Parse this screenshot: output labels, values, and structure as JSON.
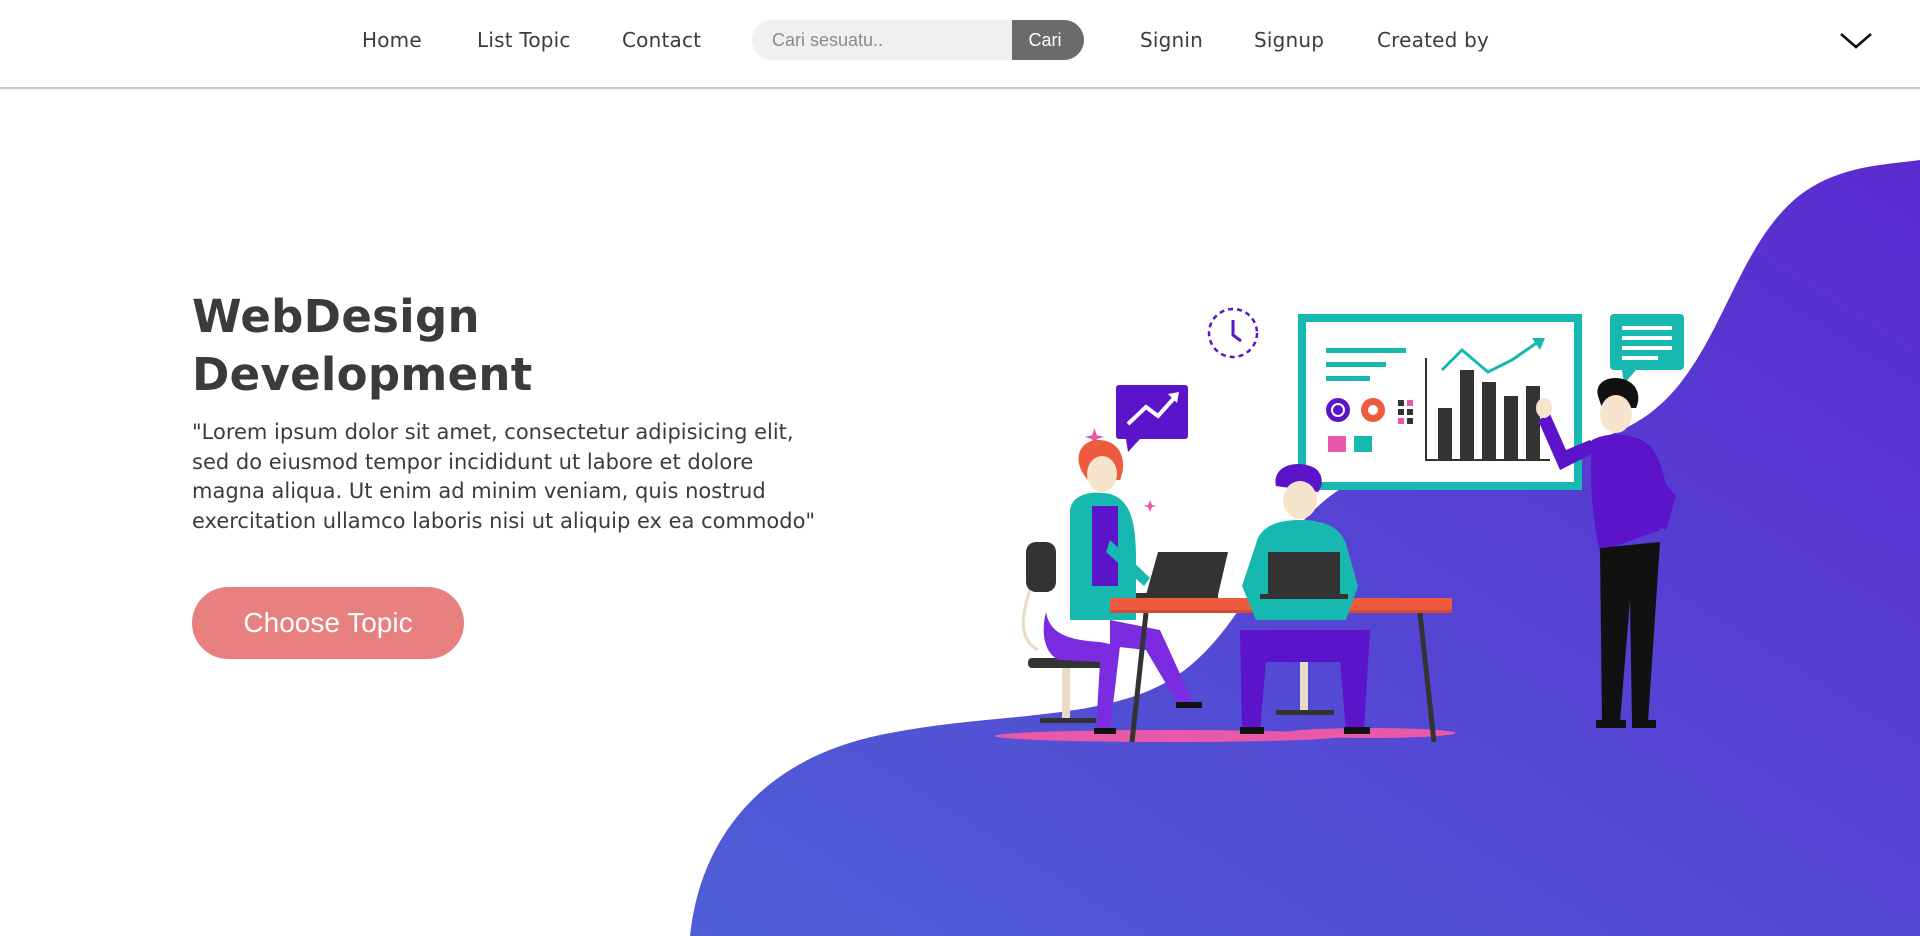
{
  "nav": {
    "links": [
      "Home",
      "List Topic",
      "Contact",
      "Signin",
      "Signup",
      "Created by"
    ],
    "search_placeholder": "Cari sesuatu..",
    "search_button": "Cari",
    "menu_icon": "chevron-down-icon"
  },
  "hero": {
    "title_line1": "WebDesign",
    "title_line2": "Development",
    "text": "\"Lorem ipsum dolor sit amet, consectetur adipisicing elit, sed do eiusmod tempor incididunt ut labore et dolore magna aliqua. Ut enim ad minim veniam, quis nostrud exercitation ullamco laboris nisi ut aliquip ex ea commodo\"",
    "cta": "Choose Topic"
  },
  "colors": {
    "blob_start": "#4f5fd6",
    "blob_end": "#5a2bd0",
    "cta": "#e8807f",
    "teal": "#16b8b0",
    "purple": "#5b14c9",
    "desk": "#ee5a3e"
  }
}
